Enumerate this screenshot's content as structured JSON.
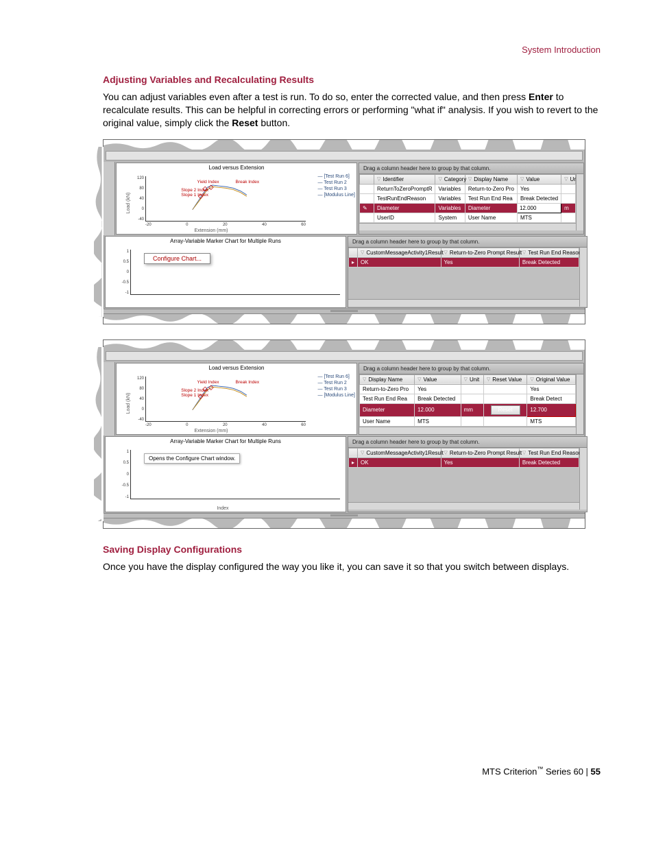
{
  "header": {
    "section": "System Introduction"
  },
  "h1": "Adjusting Variables and Recalculating Results",
  "para1_a": "You can adjust variables even after a test is run. To do so, enter the corrected value, and then press ",
  "para1_b": "Enter",
  "para1_c": " to recalculate results. This can be helpful in correcting errors or performing \"what if\" analysis. If you wish to revert to the original value, simply click the ",
  "para1_d": "Reset",
  "para1_e": " button.",
  "h2": "Saving Display Configurations",
  "para2": "Once you have the display configured the way you like it, you can save it so that you switch between displays.",
  "footer": {
    "brand": "MTS Criterion",
    "series": " Series 60 | ",
    "page": "55"
  },
  "chart_data": [
    {
      "type": "line",
      "title": "Load versus Extension",
      "xlabel": "Extension (mm)",
      "ylabel": "Load (kN)",
      "xlim": [
        -20,
        60
      ],
      "ylim": [
        -40,
        120
      ],
      "xticks": [
        -20,
        0,
        20,
        40,
        60
      ],
      "yticks": [
        -40,
        0,
        40,
        80,
        120
      ],
      "series": [
        {
          "name": "[Test Run 6]"
        },
        {
          "name": "Test Run 2"
        },
        {
          "name": "Test Run 3"
        },
        {
          "name": "[Modulus Line]"
        }
      ],
      "annotations": [
        "Yield Index",
        "Break Index",
        "Slope 2 Index",
        "Slope 1 Index"
      ]
    },
    {
      "type": "line",
      "title": "Array-Variable Marker Chart for Multiple Runs",
      "xlabel": "Index",
      "ylabel": "",
      "ylim": [
        -1,
        1
      ],
      "yticks": [
        -1,
        -0.5,
        0,
        0.5,
        1
      ],
      "series": []
    }
  ],
  "shot1": {
    "groupHint": "Drag a column header here to group by that column.",
    "contextMenu": "Configure Chart...",
    "tbl1": {
      "headers": [
        "Identifier",
        "Category",
        "Display Name",
        "Value",
        "Un"
      ],
      "rows": [
        [
          "ReturnToZeroPromptR",
          "Variables",
          "Return-to-Zero Pro",
          "Yes",
          ""
        ],
        [
          "TestRunEndReason",
          "Variables",
          "Test Run End Rea",
          "Break Detected",
          ""
        ],
        [
          "Diameter",
          "Variables",
          "Diameter",
          "12.000",
          "m"
        ],
        [
          "UserID",
          "System",
          "User Name",
          "MTS",
          ""
        ]
      ],
      "selectedRow": 2,
      "editCol": 3
    },
    "tbl2": {
      "headers": [
        "CustomMessageActivity1Result",
        "Return-to-Zero Prompt Result",
        "Test Run End Reason"
      ],
      "rows": [
        [
          "OK",
          "Yes",
          "Break Detected"
        ]
      ]
    }
  },
  "shot2": {
    "groupHint": "Drag a column header here to group by that column.",
    "tooltip": "Opens the Configure Chart window.",
    "resetLabel": "Reset",
    "tbl1": {
      "headers": [
        "Display Name",
        "Value",
        "Unit",
        "Reset Value",
        "Original Value"
      ],
      "rows": [
        [
          "Return-to-Zero Pro",
          "Yes",
          "",
          "",
          "Yes"
        ],
        [
          "Test Run End Rea",
          "Break Detected",
          "",
          "",
          "Break Detect"
        ],
        [
          "Diameter",
          "12.000",
          "mm",
          "Reset",
          "12.700"
        ],
        [
          "User Name",
          "MTS",
          "",
          "",
          "MTS"
        ]
      ],
      "selectedRow": 2
    },
    "tbl2": {
      "headers": [
        "CustomMessageActivity1Result",
        "Return-to-Zero Prompt Result",
        "Test Run End Reason"
      ],
      "rows": [
        [
          "OK",
          "Yes",
          "Break Detected"
        ]
      ]
    }
  }
}
